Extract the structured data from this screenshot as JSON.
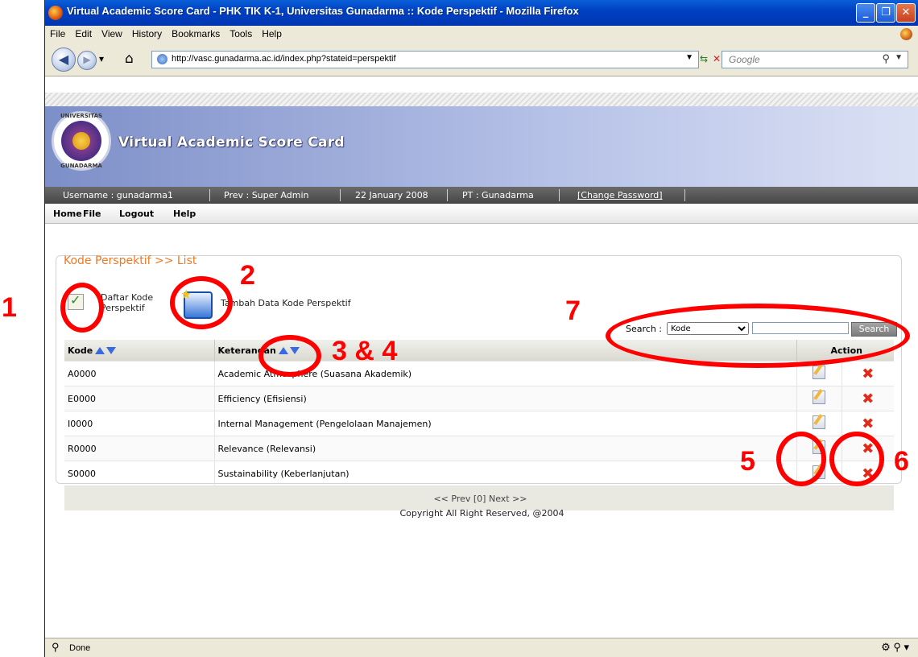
{
  "window": {
    "title": "Virtual Academic Score Card - PHK TIK K-1, Universitas Gunadarma :: Kode Perspektif - Mozilla Firefox",
    "menu": [
      "File",
      "Edit",
      "View",
      "History",
      "Bookmarks",
      "Tools",
      "Help"
    ],
    "url": "http://vasc.gunadarma.ac.id/index.php?stateid=perspektif",
    "search_placeholder": "Google",
    "status": "Done"
  },
  "site": {
    "seal_top": "UNIVERSITAS",
    "seal_bottom": "GUNADARMA",
    "brand": "Virtual Academic Score Card",
    "info": {
      "username": "Username : gunadarma1",
      "prev": "Prev : Super Admin",
      "date": "22 January 2008",
      "pt": "PT : Gunadarma",
      "change_password": "[Change Password]"
    },
    "nav": [
      "Home",
      "File",
      "Logout",
      "Help"
    ]
  },
  "panel": {
    "title": "Kode Perspektif >> List",
    "daftar_label": "Daftar Kode Perspektif",
    "tambah_label": "Tambah Data Kode Perspektif",
    "search_label": "Search :",
    "search_field": "Kode",
    "search_button": "Search",
    "columns": {
      "kode": "Kode",
      "keterangan": "Keterangan",
      "action": "Action"
    },
    "rows": [
      {
        "kode": "A0000",
        "keterangan": "Academic Atmosphere (Suasana Akademik)"
      },
      {
        "kode": "E0000",
        "keterangan": "Efficiency (Efisiensi)"
      },
      {
        "kode": "I0000",
        "keterangan": "Internal Management (Pengelolaan Manajemen)"
      },
      {
        "kode": "R0000",
        "keterangan": "Relevance (Relevansi)"
      },
      {
        "kode": "S0000",
        "keterangan": "Sustainability (Keberlanjutan)"
      }
    ],
    "pager": "<< Prev [0] Next >>"
  },
  "copyright": "Copyright All Right Reserved, @2004",
  "annotations": [
    "1",
    "2",
    "3 & 4",
    "5",
    "6",
    "7"
  ],
  "colors": {
    "accent": "#f07821",
    "annotation": "#ff0000"
  }
}
